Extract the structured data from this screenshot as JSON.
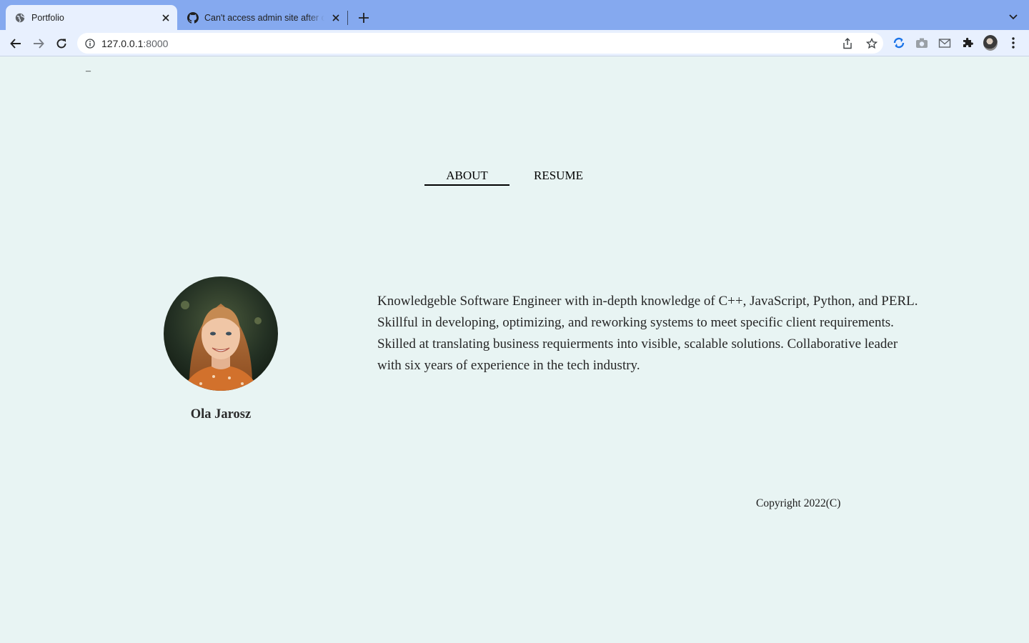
{
  "browser": {
    "tabs": [
      {
        "title": "Portfolio",
        "icon": "globe-icon",
        "active": true
      },
      {
        "title": "Can't access admin site after changing",
        "icon": "github-icon",
        "active": false
      }
    ],
    "url_host": "127.0.0.1",
    "url_port": ":8000",
    "accent": "#85a9ef"
  },
  "page": {
    "top_dash": "–",
    "nav": {
      "about": "ABOUT",
      "resume": "RESUME"
    },
    "profile": {
      "name": "Ola Jarosz",
      "photo_icon": "profile-photo"
    },
    "bio": "Knowledgeble Software Engineer with in-depth knowledge of C++, JavaScript, Python, and PERL. Skillful in developing, optimizing, and reworking systems to meet specific client requirements. Skilled at translating business requierments into visible, scalable solutions. Collaborative leader with six years of experience in the tech industry.",
    "footer": {
      "copyright": "Copyright 2022(C)"
    },
    "background": "#e8f4f3"
  }
}
